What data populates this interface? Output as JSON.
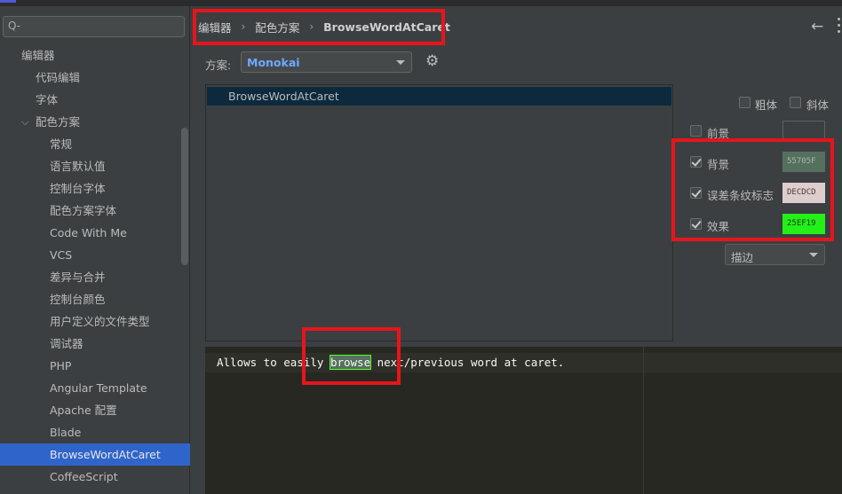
{
  "sidebar": {
    "search_placeholder": "Q-",
    "items": [
      {
        "label": "编辑器",
        "level": 0
      },
      {
        "label": "代码编辑",
        "level": 1
      },
      {
        "label": "字体",
        "level": 1
      },
      {
        "label": "配色方案",
        "level": 1,
        "expanded": true
      },
      {
        "label": "常规",
        "level": 2
      },
      {
        "label": "语言默认值",
        "level": 2
      },
      {
        "label": "控制台字体",
        "level": 2
      },
      {
        "label": "配色方案字体",
        "level": 2
      },
      {
        "label": "Code With Me",
        "level": 2
      },
      {
        "label": "VCS",
        "level": 2
      },
      {
        "label": "差异与合并",
        "level": 2
      },
      {
        "label": "控制台颜色",
        "level": 2
      },
      {
        "label": "用户定义的文件类型",
        "level": 2
      },
      {
        "label": "调试器",
        "level": 2
      },
      {
        "label": "PHP",
        "level": 2
      },
      {
        "label": "Angular Template",
        "level": 2
      },
      {
        "label": "Apache 配置",
        "level": 2
      },
      {
        "label": "Blade",
        "level": 2
      },
      {
        "label": "BrowseWordAtCaret",
        "level": 2,
        "selected": true
      },
      {
        "label": "CoffeeScript",
        "level": 2
      }
    ]
  },
  "breadcrumb": {
    "items": [
      "编辑器",
      "配色方案",
      "BrowseWordAtCaret"
    ]
  },
  "scheme": {
    "label": "方案:",
    "value": "Monokai"
  },
  "attribute_list": {
    "items": [
      "BrowseWordAtCaret"
    ]
  },
  "options": {
    "bold": {
      "label": "粗体",
      "checked": false
    },
    "italic": {
      "label": "斜体",
      "checked": false
    },
    "foreground": {
      "label": "前景",
      "checked": false,
      "value": ""
    },
    "background": {
      "label": "背景",
      "checked": true,
      "value": "55705F",
      "color": "#55705f"
    },
    "error_stripe": {
      "label": "误差条纹标志",
      "checked": true,
      "value": "DECDCD",
      "color": "#decdcd"
    },
    "effects": {
      "label": "效果",
      "checked": true,
      "value": "25EF19",
      "color": "#25ef19"
    },
    "effect_type": "描边"
  },
  "preview": {
    "before": "Allows to easily ",
    "hit": "browse",
    "after": " next/previous word at caret."
  },
  "colors": {
    "highlight_red": "#e8141c",
    "selection_blue": "#2f65ca",
    "editor_bg": "#272822"
  }
}
